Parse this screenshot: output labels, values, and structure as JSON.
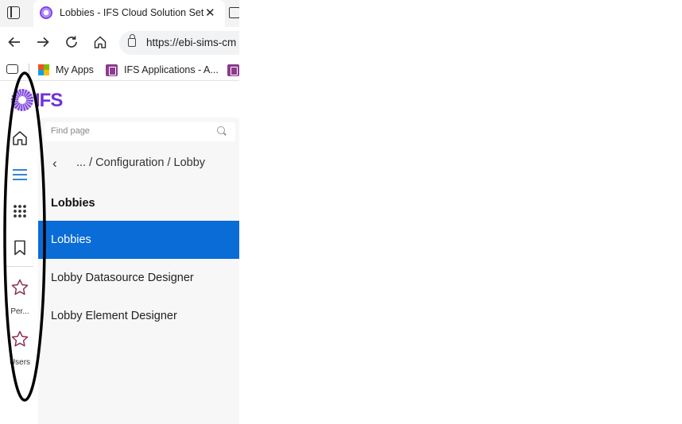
{
  "browser": {
    "tab_title": "Lobbies - IFS Cloud Solution Set",
    "tab_close": "✕",
    "url": "https://ebi-sims-cm",
    "bookmarks": [
      {
        "label": "My Apps",
        "icon": "microsoft-logo-icon"
      },
      {
        "label": "IFS Applications - A...",
        "icon": "ifs-favicon-icon"
      }
    ]
  },
  "app": {
    "logo_text": "IFS",
    "rail": {
      "items": [
        {
          "icon": "home-icon",
          "label": ""
        },
        {
          "icon": "menu-icon",
          "label": ""
        },
        {
          "icon": "apps-grid-icon",
          "label": ""
        },
        {
          "icon": "bookmark-icon",
          "label": ""
        },
        {
          "icon": "star-icon",
          "label": "Per..."
        },
        {
          "icon": "star-icon",
          "label": "Users"
        }
      ]
    },
    "nav_panel": {
      "search_placeholder": "Find page",
      "back_icon": "‹",
      "breadcrumb": "... / Configuration / Lobby",
      "section_title": "Lobbies",
      "items": [
        {
          "label": "Lobbies",
          "active": true
        },
        {
          "label": "Lobby Datasource Designer",
          "active": false
        },
        {
          "label": "Lobby Element Designer",
          "active": false
        }
      ]
    }
  },
  "colors": {
    "active_item": "#0a6cd6",
    "accent_blue": "#1a73c8",
    "star": "#8e2f57",
    "ifs_purple": "#6f32d6"
  }
}
